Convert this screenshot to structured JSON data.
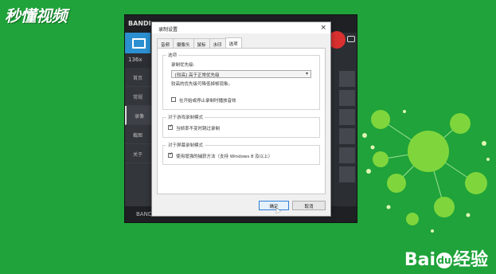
{
  "watermark": {
    "text": "秒懂视频"
  },
  "baidu": {
    "bai": "Bai",
    "paw": "du",
    "jingyan": "经验"
  },
  "app": {
    "brand": "BANDI",
    "count": "136x",
    "side_items": [
      "首页",
      "常规",
      "录像",
      "截图",
      "关于"
    ],
    "bottom": "BANDI"
  },
  "dialog": {
    "title": "录制设置",
    "close": "×",
    "tabs": [
      "音频",
      "摄像头",
      "鼠标",
      "水印",
      "选项"
    ],
    "active_tab": "选项",
    "groups": {
      "options": {
        "legend": "选项",
        "priority_label": "录制优先级:",
        "priority_value": "[较高] 高于正常优先级",
        "priority_hint": "较高的优先级可降低掉帧现象。",
        "checkbox_label": "在开始或停止录制时播放音效",
        "checkbox_checked": false
      },
      "game_mode": {
        "legend": "对于游戏录制模式",
        "checkbox_label": "当帧率不变时跳过录制",
        "checkbox_checked": true
      },
      "screen_mode": {
        "legend": "对于屏幕录制模式",
        "checkbox_label": "使用增强的捕获方法（支持 Windows 8 及以上）",
        "checkbox_checked": true
      }
    },
    "ok_label": "确定",
    "cancel_label": "取消"
  },
  "colors": {
    "background": "#1fa33a",
    "accent": "#2c8fd1",
    "record": "#d93030"
  }
}
